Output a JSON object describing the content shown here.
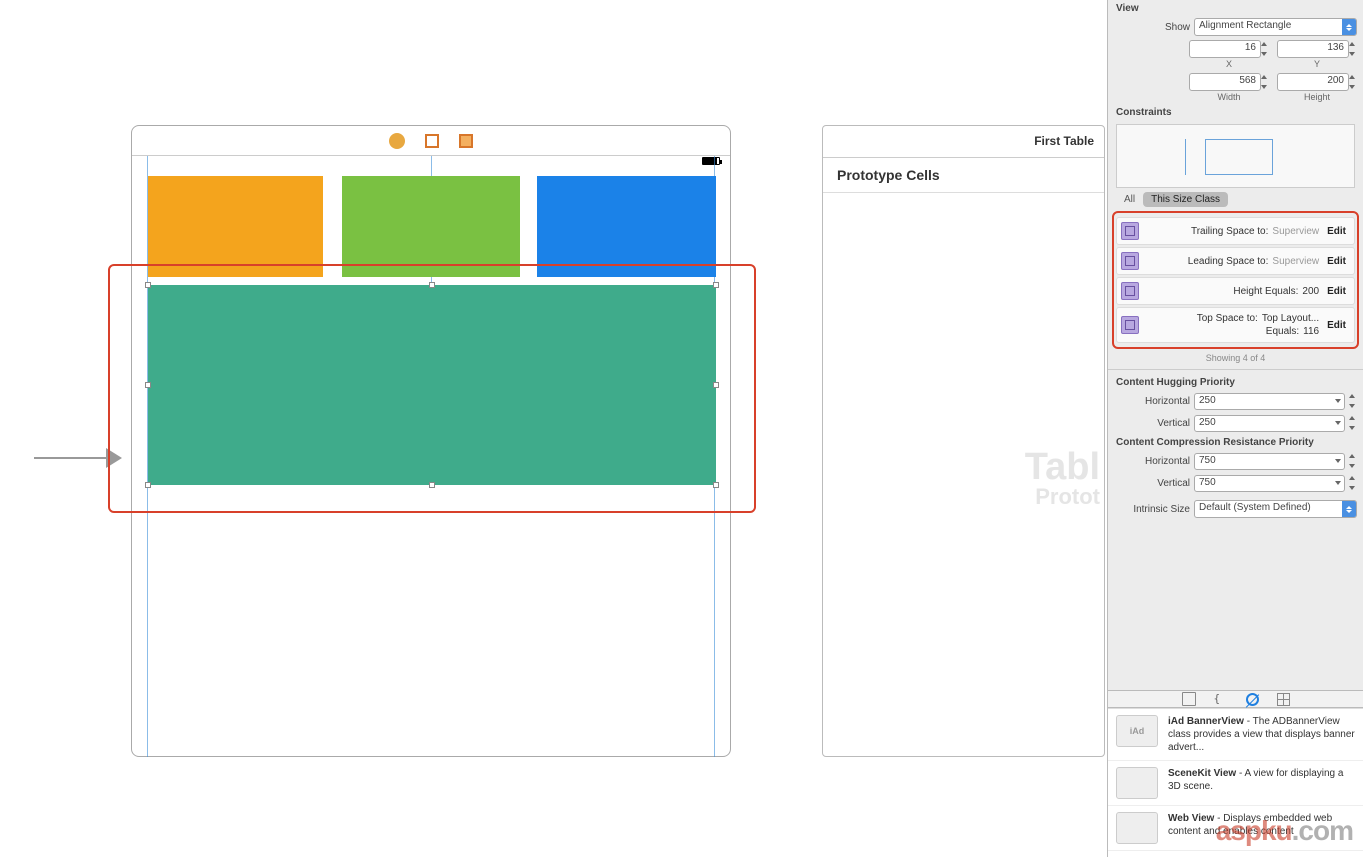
{
  "outline": {
    "header": "First Table",
    "row": "Prototype Cells",
    "watermark_main": "Tabl",
    "watermark_sub": "Protot"
  },
  "inspector": {
    "section_view": "View",
    "show_label": "Show",
    "show_value": "Alignment Rectangle",
    "x": {
      "value": "16",
      "label": "X"
    },
    "y": {
      "value": "136",
      "label": "Y"
    },
    "width": {
      "value": "568",
      "label": "Width"
    },
    "height": {
      "value": "200",
      "label": "Height"
    },
    "section_constraints": "Constraints",
    "tabs": {
      "all": "All",
      "this_size": "This Size Class"
    },
    "constraints": [
      {
        "label": "Trailing Space to:",
        "value": "Superview",
        "muted": true,
        "edit": "Edit"
      },
      {
        "label": "Leading Space to:",
        "value": "Superview",
        "muted": true,
        "edit": "Edit"
      },
      {
        "label": "Height Equals:",
        "value": "200",
        "muted": false,
        "edit": "Edit"
      },
      {
        "label": "Top Space to:",
        "value": "Top Layout...",
        "line2_label": "Equals:",
        "line2_value": "116",
        "muted": false,
        "edit": "Edit"
      }
    ],
    "showing": "Showing 4 of 4",
    "chp_title": "Content Hugging Priority",
    "horizontal_label": "Horizontal",
    "vertical_label": "Vertical",
    "chp_h": "250",
    "chp_v": "250",
    "ccrp_title": "Content Compression Resistance Priority",
    "ccrp_h": "750",
    "ccrp_v": "750",
    "intrinsic_label": "Intrinsic Size",
    "intrinsic_value": "Default (System Defined)"
  },
  "library": {
    "items": [
      {
        "icon": "iAd",
        "title": "iAd BannerView",
        "desc": " - The ADBannerView class provides a view that displays banner advert..."
      },
      {
        "icon": "",
        "title": "SceneKit View",
        "desc": " - A view for displaying a 3D scene."
      },
      {
        "icon": "",
        "title": "Web View",
        "desc": " - Displays embedded web content and enables content"
      }
    ]
  },
  "watermark": {
    "main": "aspku",
    "suffix": ".com"
  }
}
